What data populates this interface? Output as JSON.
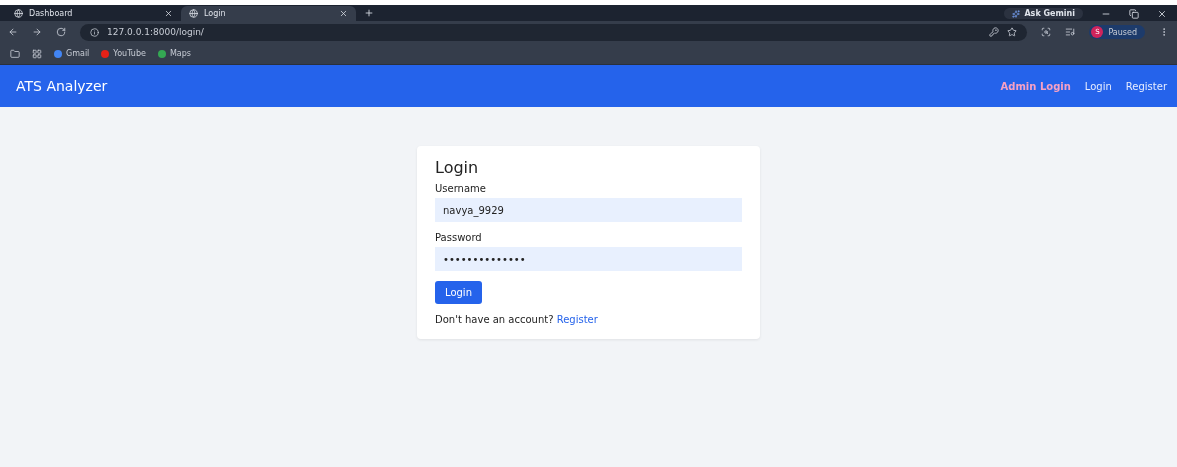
{
  "browser": {
    "tabs": [
      {
        "title": "Dashboard",
        "selected": false
      },
      {
        "title": "Login",
        "selected": true
      }
    ],
    "ask_gemini": "Ask Gemini",
    "url": "127.0.0.1:8000/login/",
    "profile_initial": "S",
    "profile_status": "Paused",
    "bookmarks": [
      {
        "label": "Gmail",
        "color": "#4285f4"
      },
      {
        "label": "YouTube",
        "color": "#e62117"
      },
      {
        "label": "Maps",
        "color": "#34a853"
      }
    ]
  },
  "navbar": {
    "brand": "ATS Analyzer",
    "links": [
      {
        "label": "Admin Login",
        "kind": "highlight"
      },
      {
        "label": "Login",
        "kind": "plain"
      },
      {
        "label": "Register",
        "kind": "plain"
      }
    ]
  },
  "form": {
    "title": "Login",
    "fields": [
      {
        "label": "Username",
        "value": "navya_9929"
      },
      {
        "label": "Password",
        "value": "••••••••••••••"
      }
    ],
    "submit": "Login",
    "footer_text": "Don't have an account?",
    "footer_link": "Register"
  }
}
